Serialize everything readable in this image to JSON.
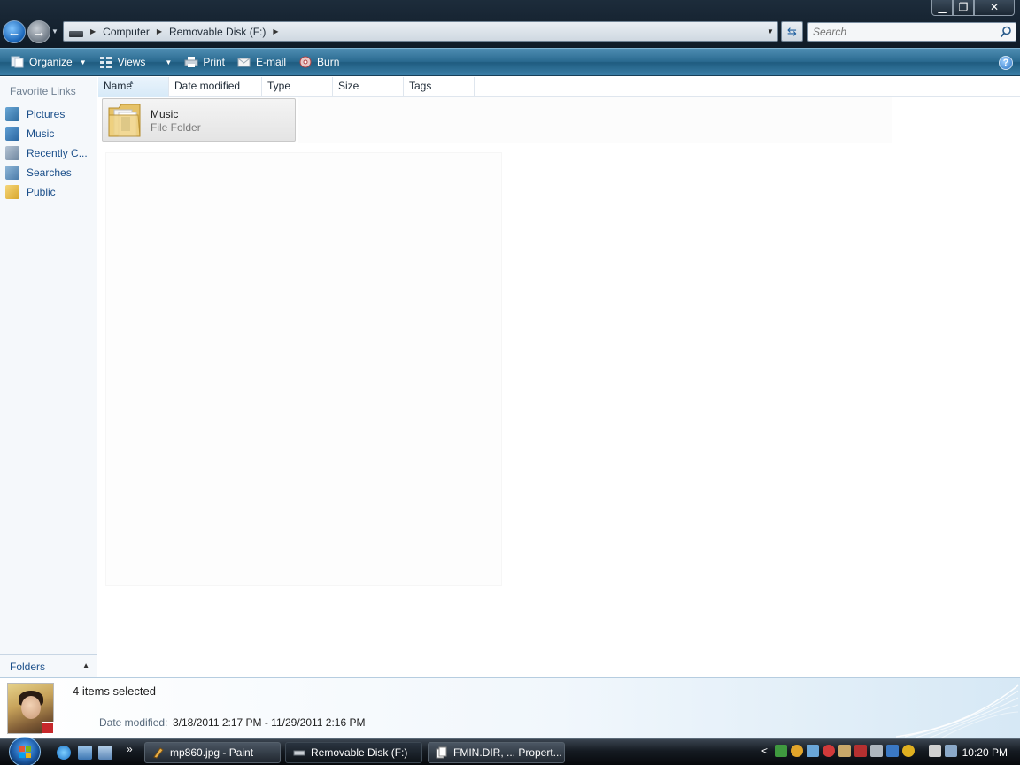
{
  "window": {
    "controls": {
      "minimize": "▁",
      "maximize": "❐",
      "close": "✕"
    }
  },
  "address": {
    "crumbs": [
      "Computer",
      "Removable Disk (F:)"
    ],
    "search_placeholder": "Search"
  },
  "commands": {
    "organize": "Organize",
    "views": "Views",
    "print": "Print",
    "email": "E-mail",
    "burn": "Burn",
    "help": "?"
  },
  "nav": {
    "favorites_title": "Favorite Links",
    "items": [
      {
        "label": "Pictures",
        "icon": "pictures-icon"
      },
      {
        "label": "Music",
        "icon": "music-icon"
      },
      {
        "label": "Recently C...",
        "icon": "recent-icon"
      },
      {
        "label": "Searches",
        "icon": "searches-icon"
      },
      {
        "label": "Public",
        "icon": "public-folder-icon"
      }
    ],
    "folders_label": "Folders"
  },
  "columns": [
    "Name",
    "Date modified",
    "Type",
    "Size",
    "Tags"
  ],
  "files": [
    {
      "name": "Music",
      "type": "File Folder"
    }
  ],
  "details": {
    "selection": "4 items selected",
    "date_label": "Date modified:",
    "date_value": "3/18/2011 2:17 PM - 11/29/2011 2:16 PM"
  },
  "taskbar": {
    "buttons": [
      {
        "label": "mp860.jpg - Paint"
      },
      {
        "label": "Removable Disk (F:)"
      },
      {
        "label": "FMIN.DIR, ... Propert..."
      }
    ],
    "more": "»",
    "tray_expand": "<",
    "clock": "10:20 PM"
  },
  "colors": {
    "command_bar": "#2a6a90",
    "link_text": "#1b4f8a",
    "title_bar": "#0f1b27"
  }
}
